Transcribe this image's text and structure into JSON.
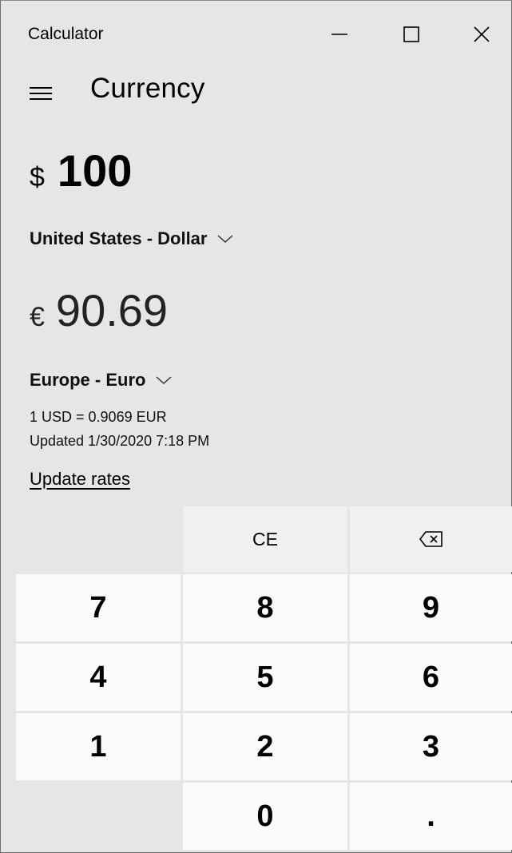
{
  "window": {
    "title": "Calculator"
  },
  "header": {
    "mode": "Currency"
  },
  "from": {
    "symbol": "$",
    "amount": "100",
    "currency": "United States - Dollar"
  },
  "to": {
    "symbol": "€",
    "amount": "90.69",
    "currency": "Europe - Euro"
  },
  "rate": {
    "line": "1 USD = 0.9069 EUR",
    "updated": "Updated 1/30/2020 7:18 PM",
    "update_link": "Update rates"
  },
  "keypad": {
    "ce": "CE",
    "backspace_icon": "backspace-icon",
    "seven": "7",
    "eight": "8",
    "nine": "9",
    "four": "4",
    "five": "5",
    "six": "6",
    "one": "1",
    "two": "2",
    "three": "3",
    "zero": "0",
    "decimal": "."
  }
}
